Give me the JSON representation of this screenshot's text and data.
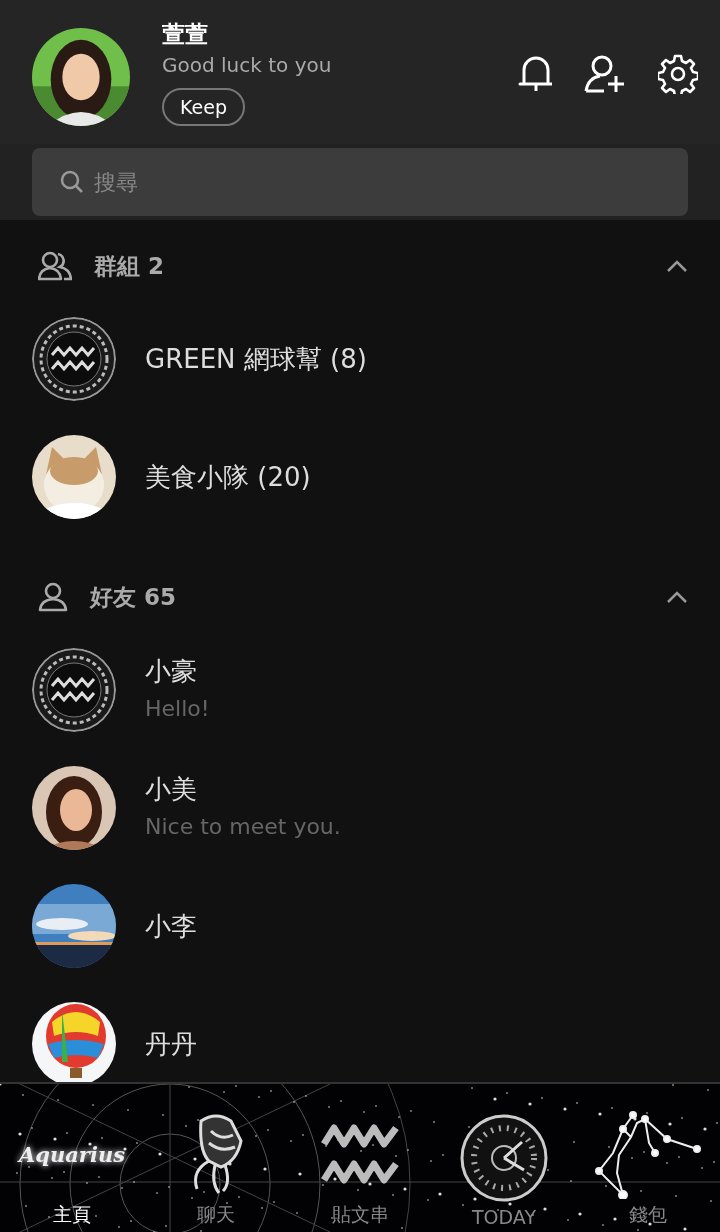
{
  "profile": {
    "name": "萱萱",
    "status": "Good luck to you",
    "button": "Keep"
  },
  "search": {
    "placeholder": "搜尋"
  },
  "sections": [
    {
      "title": "群組 2",
      "kind": "group",
      "expanded": true,
      "items": [
        {
          "name": "GREEN 網球幫 (8)",
          "kind": "symbol"
        },
        {
          "name": "美食小隊 (20)",
          "kind": "picture"
        }
      ]
    },
    {
      "title": "好友 65",
      "kind": "friend",
      "expanded": true,
      "items": [
        {
          "name": "小豪",
          "message": "Hello!",
          "kind": "symbol"
        },
        {
          "name": "小美",
          "message": "Nice to meet you.",
          "kind": "picture"
        },
        {
          "name": "小李",
          "kind": "picture"
        },
        {
          "name": "丹丹",
          "kind": "picture"
        }
      ]
    }
  ],
  "nav": [
    {
      "label": "主頁",
      "selected": true,
      "kind": "logo",
      "logo_text": "Aquarius"
    },
    {
      "label": "聊天",
      "selected": false,
      "kind": "bearer"
    },
    {
      "label": "貼文串",
      "selected": false,
      "kind": "waves"
    },
    {
      "label": "TODAY",
      "selected": false,
      "kind": "clock"
    },
    {
      "label": "錢包",
      "selected": false,
      "kind": "constellation"
    }
  ]
}
